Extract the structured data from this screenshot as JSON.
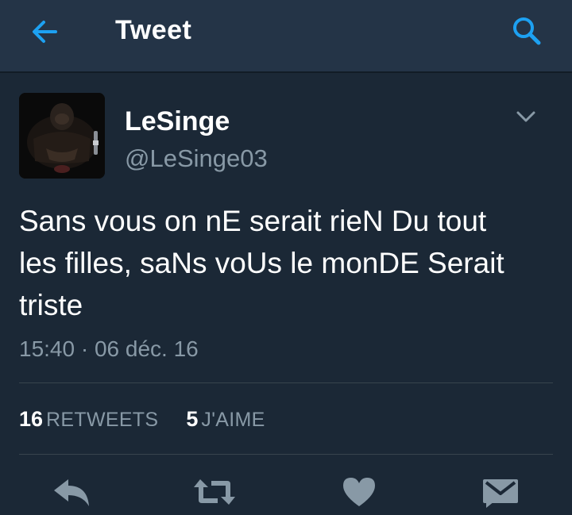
{
  "header": {
    "title": "Tweet",
    "back_icon": "back-arrow-icon",
    "search_icon": "search-icon"
  },
  "tweet": {
    "author_name": "LeSinge",
    "author_handle": "@LeSinge03",
    "text_lines": [
      "Sans vous on nE serait rieN Du tout",
      "les filles, saNs voUs le monDE Serait",
      "triste"
    ],
    "timestamp": "15:40 · 06 déc. 16",
    "stats": {
      "retweets_count": "16",
      "retweets_label": "RETWEETS",
      "likes_count": "5",
      "likes_label": "J'AIME"
    }
  },
  "actions": [
    "reply-icon",
    "retweet-icon",
    "like-icon",
    "direct-message-icon"
  ],
  "colors": {
    "background": "#1b2836",
    "header": "#243447",
    "accent": "#1da1f2",
    "secondary_text": "#8899a6",
    "icon": "#8899a6"
  }
}
